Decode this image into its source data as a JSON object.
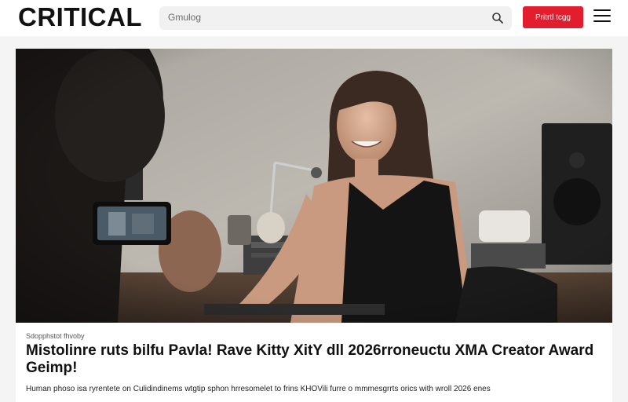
{
  "header": {
    "logo": "CRITICAL",
    "search_placeholder": "Gmulog",
    "cta_label": "Pritrtl tcgg"
  },
  "article": {
    "photo_caption": "Sdopphstot fhvoby",
    "headline": "Mistolinre ruts bilfu Pavla! Rave Kitty XitY dll 2026rroneuctu XMA Creator Award Geimp!",
    "dek": "Human phoso isa ryrentete on Culidindinems wtgtip sphon hrresomelet to frins KHOVili furre o mmmesgrrts orics with wroll 2026 enes"
  },
  "icons": {
    "search": "search-icon",
    "menu": "hamburger-menu-icon"
  },
  "colors": {
    "accent": "#e11d2e",
    "header_bg": "#ffffff",
    "page_bg": "#f4f4f4"
  }
}
